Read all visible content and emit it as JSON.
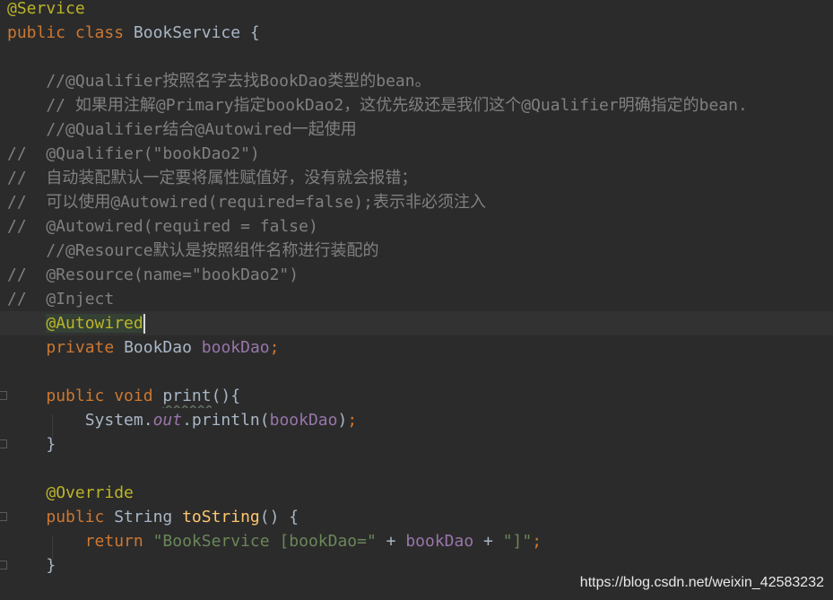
{
  "editor": {
    "lines": [
      {
        "tokens": [
          {
            "t": "@Service",
            "c": "ann"
          }
        ]
      },
      {
        "tokens": [
          {
            "t": "public ",
            "c": "kw"
          },
          {
            "t": "class ",
            "c": "kw"
          },
          {
            "t": "BookService {",
            "c": "plain"
          }
        ]
      },
      {
        "tokens": []
      },
      {
        "tokens": [
          {
            "t": "    //@Qualifier按照名字去找BookDao类型的bean。",
            "c": "cmt"
          }
        ]
      },
      {
        "tokens": [
          {
            "t": "    // 如果用注解@Primary指定bookDao2，这优先级还是我们这个@Qualifier明确指定的bean.",
            "c": "cmt"
          }
        ]
      },
      {
        "tokens": [
          {
            "t": "    //@Qualifier结合@Autowired一起使用",
            "c": "cmt"
          }
        ]
      },
      {
        "tokens": [
          {
            "t": "//  @Qualifier(\"bookDao2\")",
            "c": "cmt"
          }
        ]
      },
      {
        "tokens": [
          {
            "t": "//  自动装配默认一定要将属性赋值好，没有就会报错；",
            "c": "cmt"
          }
        ]
      },
      {
        "tokens": [
          {
            "t": "//  可以使用@Autowired(required=false);表示非必须注入",
            "c": "cmt"
          }
        ]
      },
      {
        "tokens": [
          {
            "t": "//  @Autowired(required = false)",
            "c": "cmt"
          }
        ]
      },
      {
        "tokens": [
          {
            "t": "    //@Resource默认是按照组件名称进行装配的",
            "c": "cmt"
          }
        ]
      },
      {
        "tokens": [
          {
            "t": "//  @Resource(name=\"bookDao2\")",
            "c": "cmt"
          }
        ]
      },
      {
        "tokens": [
          {
            "t": "//  @Inject",
            "c": "cmt"
          }
        ]
      },
      {
        "current": true,
        "caret": true,
        "tokens": [
          {
            "t": "    ",
            "c": "plain"
          },
          {
            "t": "@Autowired",
            "c": "ann hl-ann"
          }
        ]
      },
      {
        "tokens": [
          {
            "t": "    ",
            "c": "plain"
          },
          {
            "t": "private ",
            "c": "kw"
          },
          {
            "t": "BookDao ",
            "c": "plain"
          },
          {
            "t": "bookDao",
            "c": "fld"
          },
          {
            "t": ";",
            "c": "punc"
          }
        ]
      },
      {
        "tokens": []
      },
      {
        "tokens": [
          {
            "t": "    ",
            "c": "plain"
          },
          {
            "t": "public ",
            "c": "kw"
          },
          {
            "t": "void ",
            "c": "kw"
          },
          {
            "t": "print",
            "c": "plain squiggle"
          },
          {
            "t": "(){",
            "c": "plain"
          }
        ]
      },
      {
        "tokens": [
          {
            "t": "        System.",
            "c": "plain"
          },
          {
            "t": "out",
            "c": "fld-it"
          },
          {
            "t": ".println(",
            "c": "plain"
          },
          {
            "t": "bookDao",
            "c": "fld"
          },
          {
            "t": ")",
            "c": "plain"
          },
          {
            "t": ";",
            "c": "punc"
          }
        ]
      },
      {
        "tokens": [
          {
            "t": "    }",
            "c": "plain"
          }
        ]
      },
      {
        "tokens": []
      },
      {
        "tokens": [
          {
            "t": "    ",
            "c": "plain"
          },
          {
            "t": "@Override",
            "c": "ann"
          }
        ]
      },
      {
        "tokens": [
          {
            "t": "    ",
            "c": "plain"
          },
          {
            "t": "public ",
            "c": "kw"
          },
          {
            "t": "String ",
            "c": "plain"
          },
          {
            "t": "toString",
            "c": "fn"
          },
          {
            "t": "() {",
            "c": "plain"
          }
        ]
      },
      {
        "tokens": [
          {
            "t": "        ",
            "c": "plain"
          },
          {
            "t": "return ",
            "c": "kw"
          },
          {
            "t": "\"BookService [bookDao=\"",
            "c": "str"
          },
          {
            "t": " + ",
            "c": "plain"
          },
          {
            "t": "bookDao",
            "c": "fld"
          },
          {
            "t": " + ",
            "c": "plain"
          },
          {
            "t": "\"]\"",
            "c": "str"
          },
          {
            "t": ";",
            "c": "punc"
          }
        ]
      },
      {
        "tokens": [
          {
            "t": "    }",
            "c": "plain"
          }
        ]
      }
    ]
  },
  "watermark": "https://blog.csdn.net/weixin_42583232"
}
